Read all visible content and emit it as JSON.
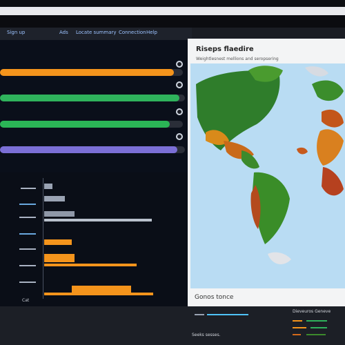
{
  "menu": {
    "items": [
      "Sign up",
      "Ads",
      "Locate summary",
      "Connection",
      "Help"
    ]
  },
  "progress": [
    {
      "name": "orange",
      "value": 0.95,
      "color": "#f4941c"
    },
    {
      "name": "green",
      "value": 0.97,
      "color": "#2fb35c"
    },
    {
      "name": "green2",
      "value": 0.93,
      "color": "#2bb556"
    },
    {
      "name": "purple",
      "value": 0.96,
      "color": "#7b6fd6"
    }
  ],
  "lower": {
    "left_label": "Cat",
    "bar_colors": [
      "#9aa3b3",
      "#f4941c"
    ]
  },
  "map": {
    "title": "Riseps flaedire",
    "subtitle": "Weightlesnest mellions and seropsering",
    "footer": "Gonos tonce"
  },
  "bottom": {
    "legend_title": "Dieveuros Geneve",
    "legend_center": "Seeks sesses."
  }
}
